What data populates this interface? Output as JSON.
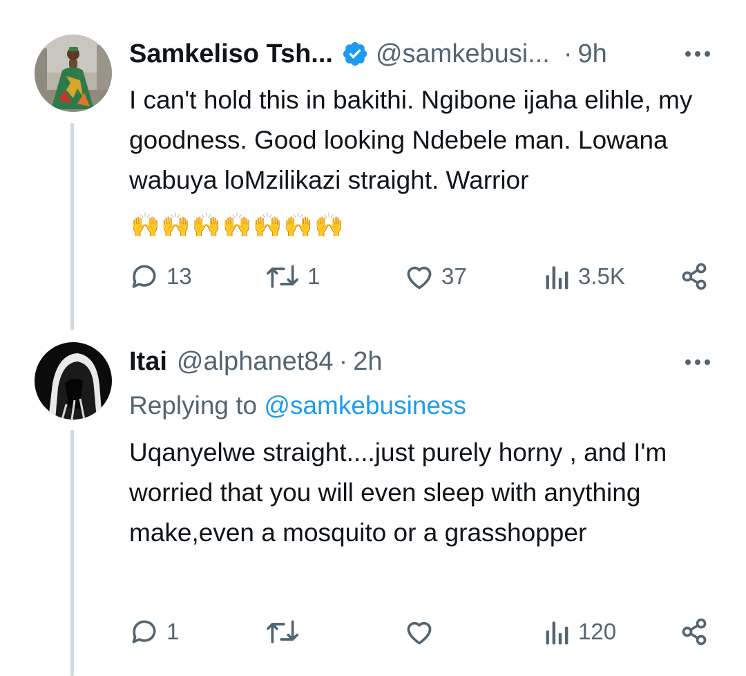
{
  "tweets": [
    {
      "author_name": "Samkeliso Tsh...",
      "verified": true,
      "handle": "@samkebusi...",
      "separator": "·",
      "time": "9h",
      "text": "I can't hold this in bakithi. Ngibone ijaha elihle, my goodness. Good looking Ndebele man. Lowana wabuya loMzilikazi straight. Warrior",
      "emoji": "🙌",
      "emoji_count": 7,
      "stats": {
        "replies": "13",
        "retweets": "1",
        "likes": "37",
        "views": "3.5K"
      }
    },
    {
      "author_name": "Itai",
      "handle": "@alphanet84",
      "separator": "·",
      "time": "2h",
      "replying_label": "Replying to",
      "replying_to": "@samkebusiness",
      "text": "Uqanyelwe straight....just purely horny , and I'm worried that you will even sleep with anything make,even a mosquito or a grasshopper",
      "stats": {
        "replies": "1",
        "retweets": "",
        "likes": "",
        "views": "120"
      }
    }
  ],
  "colors": {
    "accent": "#1d9bf0",
    "secondary_text": "#536471",
    "thread_line": "#cfd9de"
  },
  "icons": [
    "verified-badge-icon",
    "more-icon",
    "reply-icon",
    "retweet-icon",
    "like-icon",
    "views-icon",
    "share-icon"
  ]
}
